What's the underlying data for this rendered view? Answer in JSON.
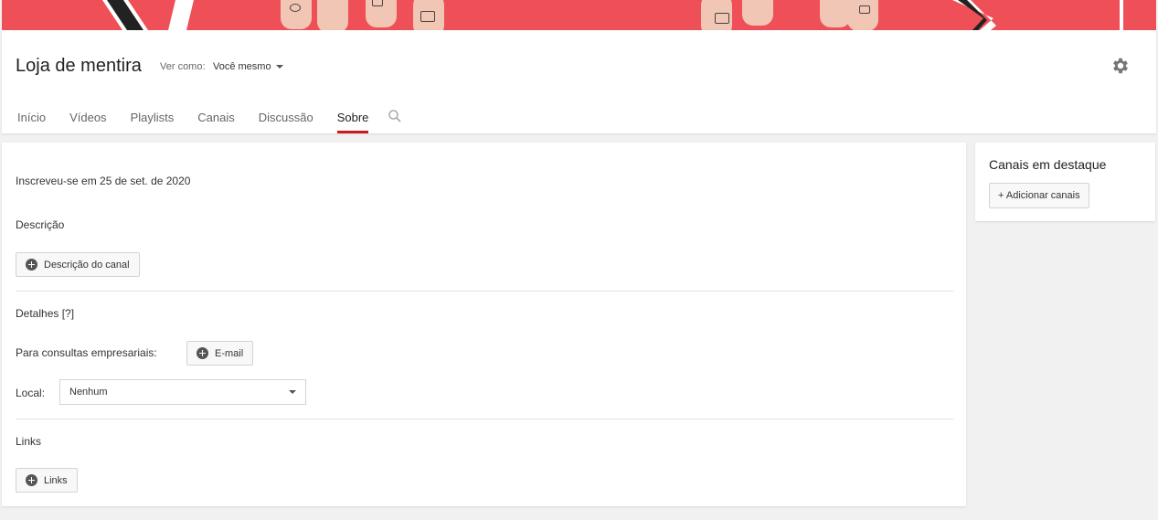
{
  "channel": {
    "title": "Loja de mentira",
    "view_as_label": "Ver como:",
    "view_as_value": "Você mesmo"
  },
  "tabs": [
    {
      "label": "Início"
    },
    {
      "label": "Vídeos"
    },
    {
      "label": "Playlists"
    },
    {
      "label": "Canais"
    },
    {
      "label": "Discussão"
    },
    {
      "label": "Sobre",
      "active": true
    }
  ],
  "about": {
    "joined": "Inscreveu-se em 25 de set. de 2020",
    "description_title": "Descrição",
    "description_button": "Descrição do canal",
    "details_title": "Detalhes [?]",
    "business_label": "Para consultas empresariais:",
    "email_button": "E-mail",
    "location_label": "Local:",
    "location_value": "Nenhum",
    "links_title": "Links",
    "links_button": "Links"
  },
  "featured": {
    "title": "Canais em destaque",
    "add_button": "+ Adicionar canais"
  },
  "colors": {
    "banner": "#ef4f56",
    "active_tab": "#cc181e"
  },
  "icons": {
    "settings": "gear-icon",
    "search": "search-icon",
    "add": "plus-circle-icon",
    "dropdown": "caret-down-icon"
  }
}
